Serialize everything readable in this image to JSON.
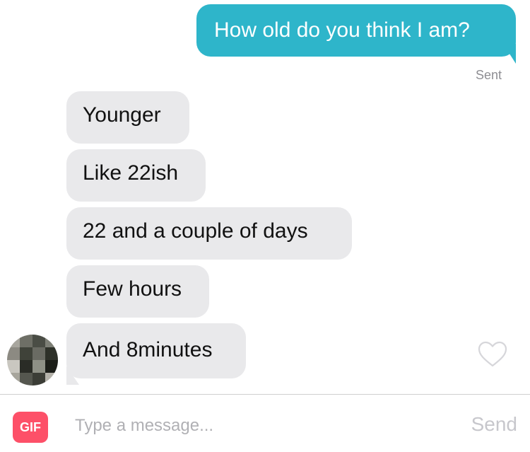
{
  "conversation": {
    "sent_message": "How old do you think I am?",
    "sent_status": "Sent",
    "received_messages": [
      "Younger",
      "Like 22ish",
      "22 and a couple of days",
      "Few hours",
      "And 8minutes"
    ],
    "avatar": "blurred-profile-photo",
    "like_icon": "heart-outline-icon"
  },
  "composer": {
    "gif_label": "GIF",
    "placeholder": "Type a message...",
    "send_label": "Send"
  },
  "colors": {
    "sent_bubble": "#2eb5ca",
    "received_bubble": "#e9e9eb",
    "gif_button": "#fd5068",
    "send_disabled": "#c7c7cc"
  }
}
